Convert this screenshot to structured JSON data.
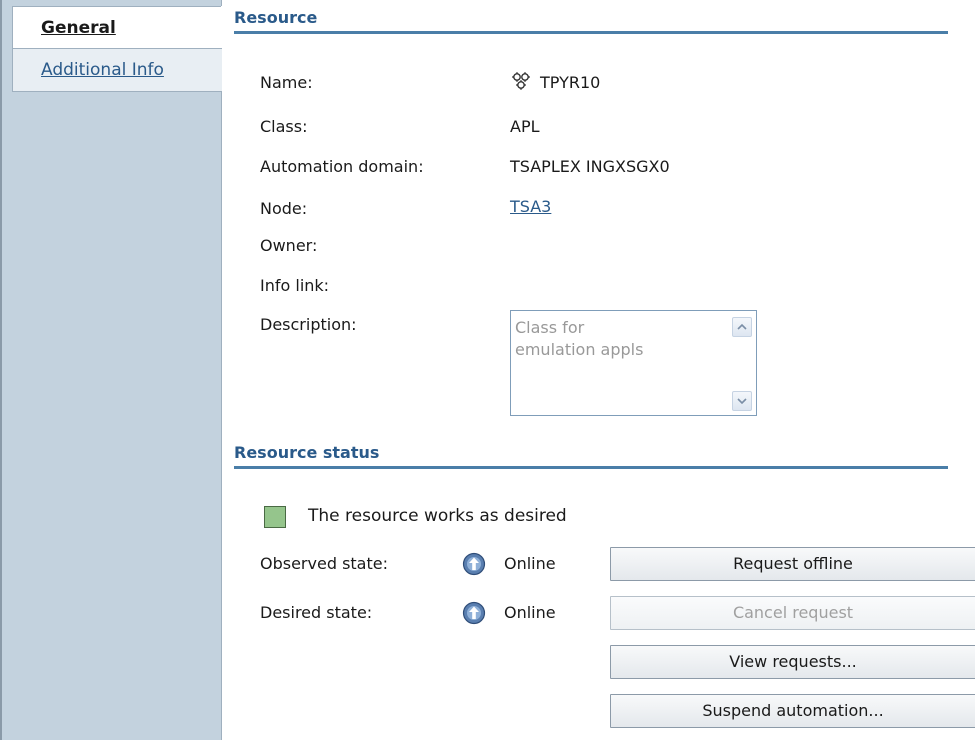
{
  "tabs": {
    "general": "General",
    "additional_info": "Additional Info"
  },
  "resource": {
    "heading": "Resource",
    "name_label": "Name:",
    "name_value": "TPYR10",
    "name_icon": "gear-cluster-icon",
    "class_label": "Class:",
    "class_value": "APL",
    "domain_label": "Automation domain:",
    "domain_value": "TSAPLEX INGXSGX0",
    "node_label": "Node:",
    "node_value": "TSA3",
    "owner_label": "Owner:",
    "owner_value": "",
    "infolink_label": "Info link:",
    "infolink_value": "",
    "description_label": "Description:",
    "description_value": "Class for\nemulation appls"
  },
  "status": {
    "heading": "Resource status",
    "summary": "The resource works as desired",
    "summary_color": "#95c58c",
    "observed_label": "Observed state:",
    "observed_value": "Online",
    "desired_label": "Desired state:",
    "desired_value": "Online",
    "state_icon": "online-up-arrow-icon"
  },
  "actions": {
    "request_offline": "Request offline",
    "cancel_request": "Cancel request",
    "view_requests": "View requests...",
    "suspend_automation": "Suspend automation..."
  },
  "colors": {
    "sidebar_bg": "#c3d2de",
    "heading": "#2a5a8a",
    "rule": "#4a7ea8"
  }
}
